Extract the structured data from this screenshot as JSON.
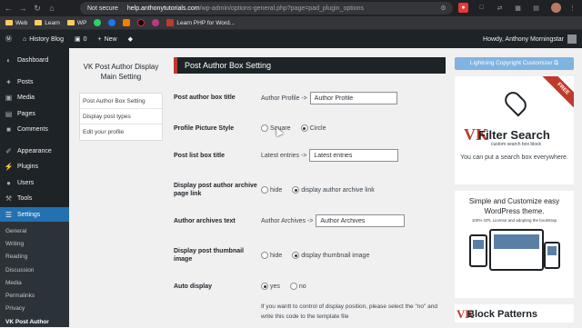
{
  "browser": {
    "security_label": "Not secure",
    "url_host": "help.anthonytutorials.com",
    "url_path": "/wp-admin/options-general.php?page=pad_plugin_options",
    "bookmarks": [
      {
        "label": "Web",
        "icon": "folder-icon"
      },
      {
        "label": "Learn",
        "icon": "folder-icon"
      },
      {
        "label": "WP",
        "icon": "folder-icon"
      },
      {
        "label": "",
        "icon": "whatsapp-icon"
      },
      {
        "label": "",
        "icon": "facebook-icon"
      },
      {
        "label": "",
        "icon": "blogger-icon"
      },
      {
        "label": "",
        "icon": "tiktok-icon"
      },
      {
        "label": "",
        "icon": "instagram-icon"
      },
      {
        "label": "Learn PHP for Word...",
        "icon": "php-icon"
      }
    ]
  },
  "adminbar": {
    "site_name": "History Blog",
    "comments_count": "0",
    "new_label": "New",
    "howdy": "Howdy, Anthony Morningstar"
  },
  "sidebar": {
    "items": [
      {
        "label": "Dashboard",
        "icon": "dashboard-icon"
      },
      {
        "label": "Posts",
        "icon": "pin-icon"
      },
      {
        "label": "Media",
        "icon": "media-icon"
      },
      {
        "label": "Pages",
        "icon": "page-icon"
      },
      {
        "label": "Comments",
        "icon": "comment-icon"
      },
      {
        "label": "Appearance",
        "icon": "brush-icon"
      },
      {
        "label": "Plugins",
        "icon": "plug-icon"
      },
      {
        "label": "Users",
        "icon": "user-icon"
      },
      {
        "label": "Tools",
        "icon": "wrench-icon"
      },
      {
        "label": "Settings",
        "icon": "sliders-icon"
      }
    ],
    "sub_items": [
      "General",
      "Writing",
      "Reading",
      "Discussion",
      "Media",
      "Permalinks",
      "Privacy",
      "VK Post Author"
    ]
  },
  "vk_nav": {
    "title": "VK Post Author Display Main Setting",
    "links": [
      "Post Author Box Setting",
      "Display post types",
      "Edit your profile"
    ]
  },
  "main": {
    "heading": "Post Author Box Setting",
    "author_box_title": {
      "label": "Post author box title",
      "prefix": "Author Profile ->",
      "value": "Author Profile"
    },
    "profile_picture_style": {
      "label": "Profile Picture Style",
      "options": [
        "Square",
        "Circle"
      ],
      "selected": "Circle"
    },
    "post_list_box_title": {
      "label": "Post list box title",
      "prefix": "Latest entries ->",
      "value": "Latest entries"
    },
    "archive_link": {
      "label": "Display post author archive page link",
      "options": [
        "hide",
        "display author archive link"
      ],
      "selected": "display author archive link"
    },
    "archives_text": {
      "label": "Author archives text",
      "prefix": "Author Archives ->",
      "value": "Author Archives"
    },
    "thumbnail": {
      "label": "Display post thumbnail image",
      "options": [
        "hide",
        "display thumbnail image"
      ],
      "selected": "display thumbnail image"
    },
    "auto_display": {
      "label": "Auto display",
      "options": [
        "yes",
        "no"
      ],
      "selected": "yes"
    },
    "note": "If you wantt to control of display position, please select the \"no\" and write this code to the template file"
  },
  "promo": {
    "customizer_btn": "Lightning Copyright Customizer ⧉",
    "filter_search": {
      "ribbon": "FREE",
      "logo": "VK",
      "title": "Filter Search",
      "subtitle": "custom search box block",
      "desc": "You can put a search box everywhere."
    },
    "lightning": {
      "title": "Simple and Customize easy WordPress theme.",
      "subtitle": "100% GPL License and adopting the bootstrap"
    },
    "block_patterns": {
      "logo": "VK",
      "title": "Block Patterns"
    }
  }
}
